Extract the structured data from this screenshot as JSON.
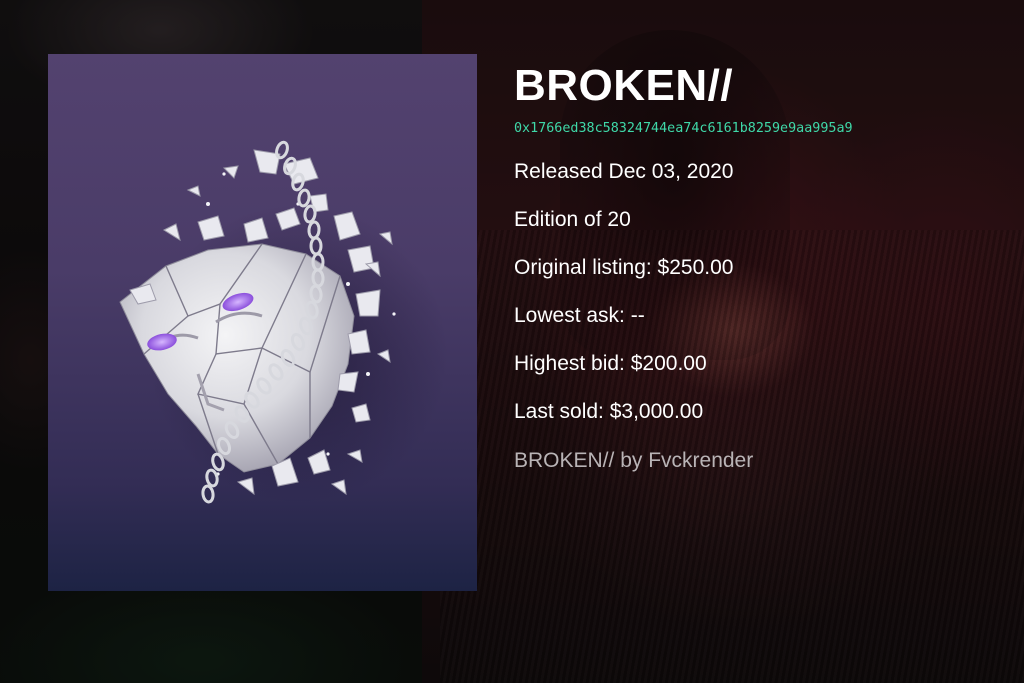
{
  "artwork": {
    "title": "BROKEN//",
    "contract_address": "0x1766ed38c58324744ea74c6161b8259e9aa995a9",
    "released": "Released Dec 03, 2020",
    "edition": "Edition of 20",
    "original_listing": "Original listing: $250.00",
    "lowest_ask": "Lowest ask: --",
    "highest_bid": "Highest bid: $200.00",
    "last_sold": "Last sold: $3,000.00",
    "credit": "BROKEN// by Fvckrender"
  },
  "colors": {
    "address_accent": "#3fd8a8",
    "text_primary": "#ffffff",
    "text_muted": "#b9b4b6",
    "artwork_background": "#4a3c68",
    "eye_glow": "#9a63e6"
  }
}
